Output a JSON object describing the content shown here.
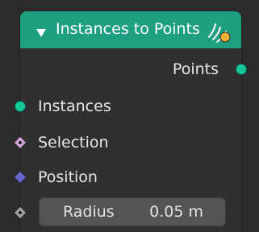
{
  "node": {
    "title": "Instances to Points",
    "outputs": [
      {
        "label": "Points",
        "socket_color": "#16c79a"
      }
    ],
    "inputs": [
      {
        "label": "Instances",
        "socket_color": "#16c79a"
      },
      {
        "label": "Selection",
        "socket_color": "#d4a3d8"
      },
      {
        "label": "Position",
        "socket_color": "#6666cc"
      },
      {
        "label": "Radius",
        "socket_color": "#a1a1a1"
      }
    ],
    "radius": {
      "label": "Radius",
      "value": "0.05 m"
    }
  },
  "colors": {
    "header": "#1e9f7f",
    "body": "#303030",
    "field": "#545454",
    "status_icon_accent": "#f2b233"
  },
  "icons": {
    "collapse": "triangle-down-icon",
    "status": "warning-cursor-icon"
  }
}
